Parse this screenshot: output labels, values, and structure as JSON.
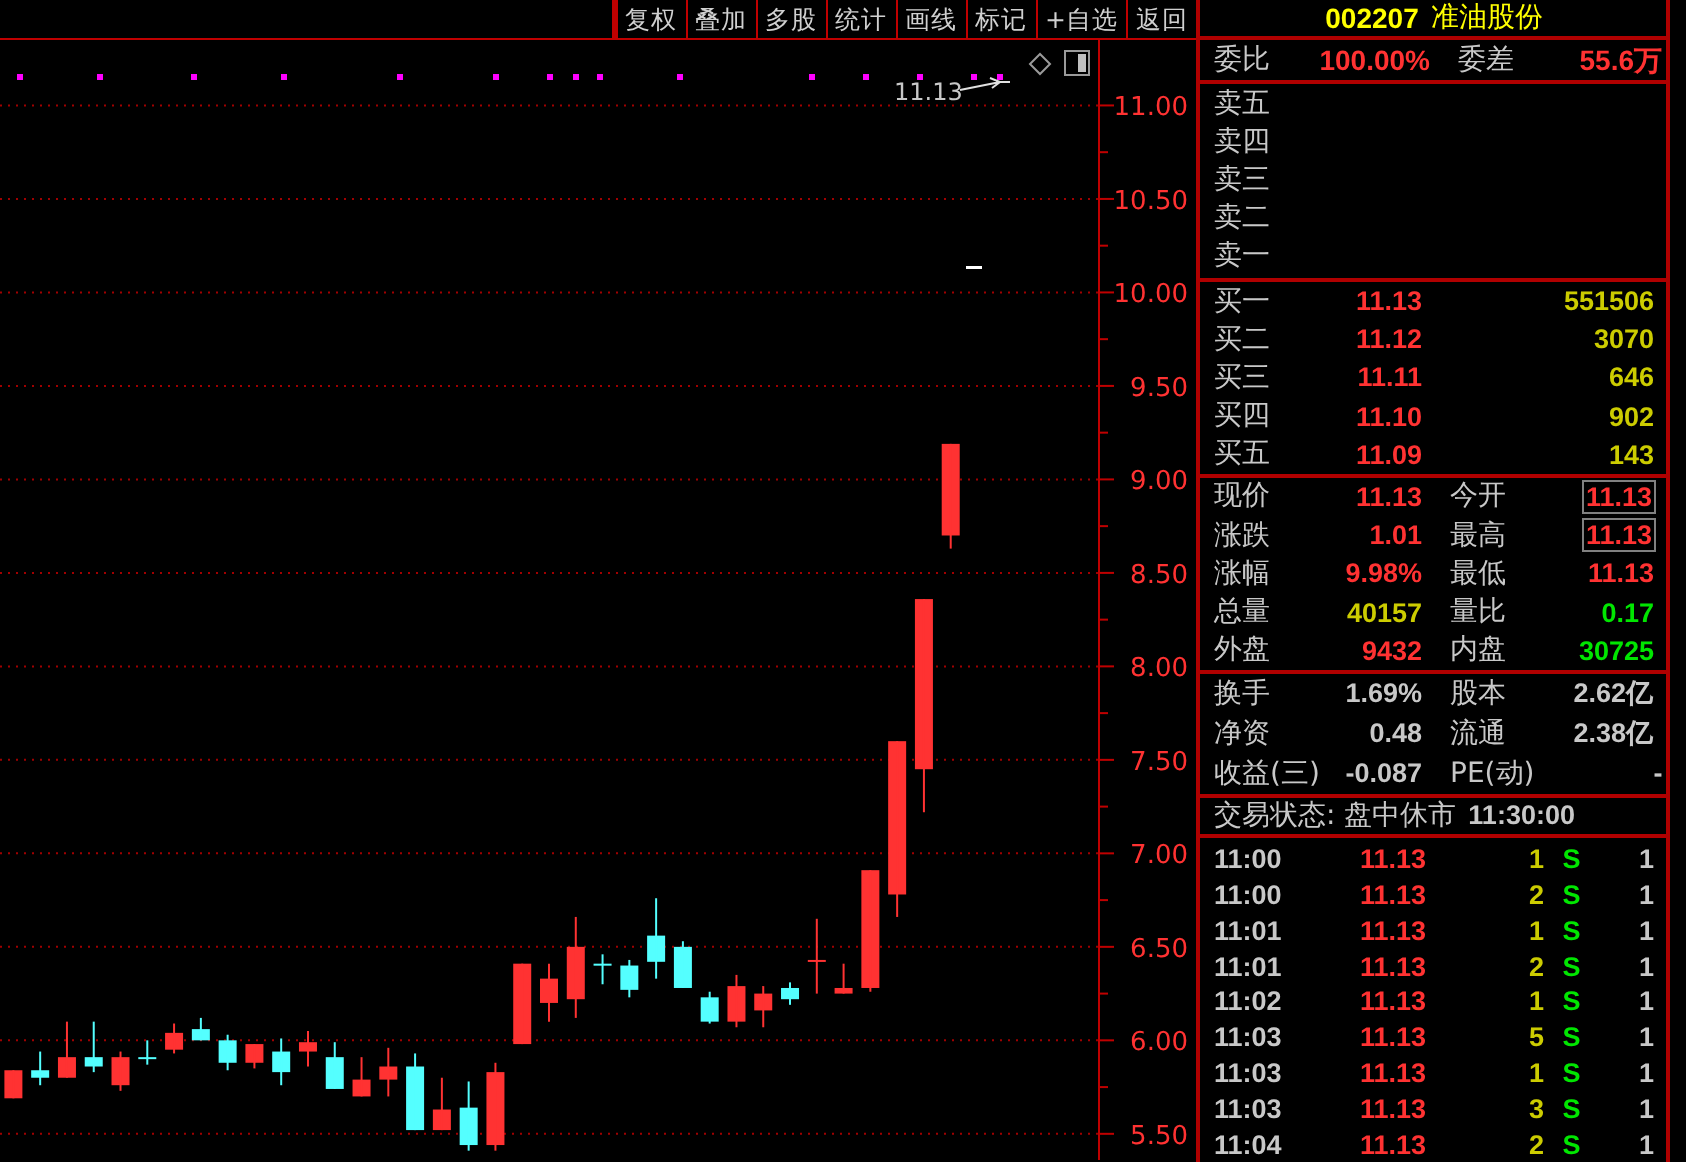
{
  "toolbar": {
    "buttons": [
      "复权",
      "叠加",
      "多股",
      "统计",
      "画线",
      "标记",
      "+自选",
      "返回"
    ]
  },
  "chart": {
    "price_label": "11.13",
    "chart_data": {
      "type": "candlestick",
      "categories": [
        null,
        null,
        null,
        null,
        null,
        null,
        null,
        null,
        null,
        null,
        null,
        null,
        null,
        null,
        null,
        null,
        null,
        null,
        null,
        null,
        null,
        null,
        null,
        null,
        null,
        null,
        null,
        null,
        null,
        null,
        null,
        null,
        null,
        null,
        null,
        null,
        null,
        null,
        null,
        null,
        null
      ],
      "ohlc": [
        [
          5.69,
          5.84,
          5.69,
          5.84
        ],
        [
          5.84,
          5.94,
          5.76,
          5.8
        ],
        [
          5.8,
          6.1,
          5.8,
          5.91
        ],
        [
          5.91,
          6.1,
          5.83,
          5.86
        ],
        [
          5.76,
          5.94,
          5.73,
          5.91
        ],
        [
          5.91,
          6.0,
          5.87,
          5.9
        ],
        [
          5.95,
          6.09,
          5.93,
          6.04
        ],
        [
          6.06,
          6.12,
          6.0,
          6.0
        ],
        [
          6.0,
          6.03,
          5.84,
          5.88
        ],
        [
          5.88,
          5.98,
          5.85,
          5.98
        ],
        [
          5.94,
          6.01,
          5.76,
          5.83
        ],
        [
          5.94,
          6.05,
          5.86,
          5.99
        ],
        [
          5.91,
          5.99,
          5.74,
          5.74
        ],
        [
          5.7,
          5.91,
          5.7,
          5.79
        ],
        [
          5.79,
          5.96,
          5.7,
          5.86
        ],
        [
          5.86,
          5.93,
          5.52,
          5.52
        ],
        [
          5.52,
          5.8,
          5.52,
          5.63
        ],
        [
          5.64,
          5.78,
          5.41,
          5.44
        ],
        [
          5.44,
          5.88,
          5.41,
          5.83
        ],
        [
          5.98,
          6.41,
          5.98,
          6.41
        ],
        [
          6.2,
          6.41,
          6.1,
          6.33
        ],
        [
          6.22,
          6.66,
          6.12,
          6.5
        ],
        [
          6.41,
          6.46,
          6.3,
          6.4
        ],
        [
          6.4,
          6.43,
          6.23,
          6.27
        ],
        [
          6.56,
          6.76,
          6.33,
          6.42
        ],
        [
          6.5,
          6.53,
          6.28,
          6.28
        ],
        [
          6.23,
          6.26,
          6.09,
          6.1
        ],
        [
          6.1,
          6.35,
          6.07,
          6.29
        ],
        [
          6.16,
          6.29,
          6.07,
          6.25
        ],
        [
          6.28,
          6.31,
          6.19,
          6.22
        ],
        [
          6.42,
          6.65,
          6.25,
          6.43
        ],
        [
          6.25,
          6.41,
          6.25,
          6.28
        ],
        [
          6.28,
          6.91,
          6.26,
          6.91
        ],
        [
          6.78,
          7.6,
          6.66,
          7.6
        ],
        [
          7.45,
          8.36,
          7.22,
          8.36
        ],
        [
          8.7,
          9.19,
          8.63,
          9.19
        ],
        null,
        null,
        null,
        null,
        null
      ],
      "ylim": [
        5.36,
        11.35
      ],
      "grid": true,
      "yticks": [
        {
          "value": 11,
          "label": "11.00"
        },
        {
          "value": 10.5,
          "label": "10.50"
        },
        {
          "value": 10,
          "label": "10.00"
        },
        {
          "value": 9.5,
          "label": "9.50"
        },
        {
          "value": 9,
          "label": "9.00"
        },
        {
          "value": 8.5,
          "label": "8.50"
        },
        {
          "value": 8,
          "label": "8.00"
        },
        {
          "value": 7.5,
          "label": "7.50"
        },
        {
          "value": 7,
          "label": "7.00"
        },
        {
          "value": 6.5,
          "label": "6.50"
        },
        {
          "value": 6,
          "label": "6.00"
        },
        {
          "value": 5.5,
          "label": "5.50"
        }
      ]
    }
  },
  "quote": {
    "code": "002207",
    "name": "准油股份",
    "ratio": [
      {
        "label": "委比",
        "value": "100.00%",
        "color": "#ff3232"
      },
      {
        "label": "委差",
        "value": "55.6万",
        "color": "#ff3232"
      }
    ],
    "asks": [
      {
        "label": "卖五"
      },
      {
        "label": "卖四"
      },
      {
        "label": "卖三"
      },
      {
        "label": "卖二"
      },
      {
        "label": "卖一"
      }
    ],
    "bids": [
      {
        "label": "买一",
        "price": "11.13",
        "volume": "551506"
      },
      {
        "label": "买二",
        "price": "11.12",
        "volume": "3070"
      },
      {
        "label": "买三",
        "price": "11.11",
        "volume": "646"
      },
      {
        "label": "买四",
        "price": "11.10",
        "volume": "902"
      },
      {
        "label": "买五",
        "price": "11.09",
        "volume": "143"
      }
    ],
    "stats": [
      {
        "label": "现价",
        "value": "11.13",
        "color": "#ff3232",
        "boxed": false
      },
      {
        "label": "今开",
        "value": "11.13",
        "color": "#ff3232",
        "boxed": true
      },
      {
        "label": "涨跌",
        "value": "1.01",
        "color": "#ff3232",
        "boxed": false
      },
      {
        "label": "最高",
        "value": "11.13",
        "color": "#ff3232",
        "boxed": true
      },
      {
        "label": "涨幅",
        "value": "9.98%",
        "color": "#ff3232",
        "boxed": false
      },
      {
        "label": "最低",
        "value": "11.13",
        "color": "#ff3232",
        "boxed": false
      },
      {
        "label": "总量",
        "value": "40157",
        "color": "#cccc00",
        "boxed": false
      },
      {
        "label": "量比",
        "value": "0.17",
        "color": "#00e600",
        "boxed": false
      },
      {
        "label": "外盘",
        "value": "9432",
        "color": "#ff3232",
        "boxed": false
      },
      {
        "label": "内盘",
        "value": "30725",
        "color": "#00e600",
        "boxed": false
      }
    ],
    "fundamentals": [
      {
        "label": "换手",
        "value": "1.69%"
      },
      {
        "label": "股本",
        "value": "2.62亿"
      },
      {
        "label": "净资",
        "value": "0.48"
      },
      {
        "label": "流通",
        "value": "2.38亿"
      },
      {
        "label": "收益(三)",
        "value": "-0.087"
      },
      {
        "label": "PE(动)",
        "value": "-"
      }
    ],
    "status": {
      "label": "交易状态: 盘中休市",
      "time": "11:30:00"
    },
    "ticks": [
      {
        "time": "11:00",
        "price": "11.13",
        "volume": "1",
        "side": "S",
        "count": "1"
      },
      {
        "time": "11:00",
        "price": "11.13",
        "volume": "2",
        "side": "S",
        "count": "1"
      },
      {
        "time": "11:01",
        "price": "11.13",
        "volume": "1",
        "side": "S",
        "count": "1"
      },
      {
        "time": "11:01",
        "price": "11.13",
        "volume": "2",
        "side": "S",
        "count": "1"
      },
      {
        "time": "11:02",
        "price": "11.13",
        "volume": "1",
        "side": "S",
        "count": "1"
      },
      {
        "time": "11:03",
        "price": "11.13",
        "volume": "5",
        "side": "S",
        "count": "1"
      },
      {
        "time": "11:03",
        "price": "11.13",
        "volume": "1",
        "side": "S",
        "count": "1"
      },
      {
        "time": "11:03",
        "price": "11.13",
        "volume": "3",
        "side": "S",
        "count": "1"
      },
      {
        "time": "11:04",
        "price": "11.13",
        "volume": "2",
        "side": "S",
        "count": "1"
      }
    ]
  }
}
